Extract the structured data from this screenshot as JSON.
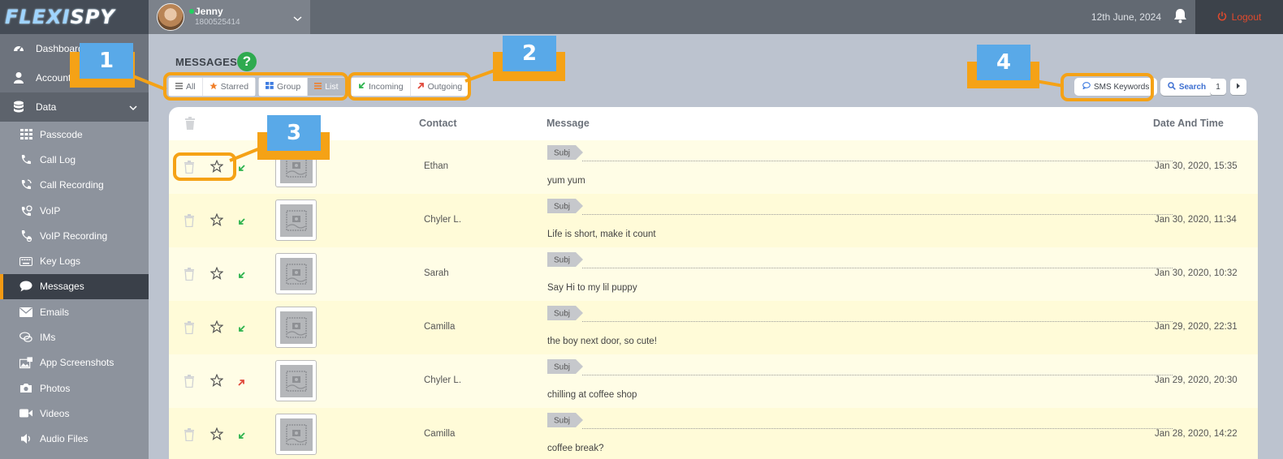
{
  "app": {
    "logo_left": "FLEXI",
    "logo_right": "SPY"
  },
  "user": {
    "name": "Jenny",
    "phone": "1800525414"
  },
  "header": {
    "date": "12th June, 2024",
    "logout_label": "Logout"
  },
  "nav": {
    "top": [
      {
        "label": "Dashboard",
        "icon": "dashboard-icon"
      },
      {
        "label": "Account",
        "icon": "user-icon"
      },
      {
        "label": "Data",
        "icon": "database-icon"
      }
    ],
    "data_items": [
      {
        "label": "Passcode",
        "icon": "grid-icon"
      },
      {
        "label": "Call Log",
        "icon": "phone-icon"
      },
      {
        "label": "Call Recording",
        "icon": "call-recording-icon"
      },
      {
        "label": "VoIP",
        "icon": "voip-icon"
      },
      {
        "label": "VoIP Recording",
        "icon": "voip-recording-icon"
      },
      {
        "label": "Key Logs",
        "icon": "keyboard-icon"
      },
      {
        "label": "Messages",
        "icon": "chat-icon",
        "active": true
      },
      {
        "label": "Emails",
        "icon": "envelope-icon"
      },
      {
        "label": "IMs",
        "icon": "ims-icon"
      },
      {
        "label": "App Screenshots",
        "icon": "screenshot-icon"
      },
      {
        "label": "Photos",
        "icon": "camera-icon"
      },
      {
        "label": "Videos",
        "icon": "video-icon"
      },
      {
        "label": "Audio Files",
        "icon": "audio-icon"
      }
    ]
  },
  "page": {
    "title": "MESSAGES",
    "help": "?",
    "filters": {
      "all": "All",
      "starred": "Starred",
      "group": "Group",
      "list": "List",
      "incoming": "Incoming",
      "outgoing": "Outgoing"
    },
    "sms_keywords": "SMS Keywords",
    "search": "Search",
    "page_number": "1"
  },
  "callouts": [
    "1",
    "2",
    "3",
    "4"
  ],
  "table": {
    "columns": {
      "contact": "Contact",
      "message": "Message",
      "date": "Date And Time"
    },
    "subject_tag": "Subj",
    "rows": [
      {
        "contact": "Ethan",
        "message": "yum yum",
        "date": "Jan 30, 2020, 15:35",
        "direction": "incoming"
      },
      {
        "contact": "Chyler L.",
        "message": "Life is short, make it count",
        "date": "Jan 30, 2020, 11:34",
        "direction": "incoming"
      },
      {
        "contact": "Sarah",
        "message": "Say Hi to my lil puppy",
        "date": "Jan 30, 2020, 10:32",
        "direction": "incoming"
      },
      {
        "contact": "Camilla",
        "message": "the boy next door, so cute!",
        "date": "Jan 29, 2020, 22:31",
        "direction": "incoming"
      },
      {
        "contact": "Chyler L.",
        "message": "chilling at coffee shop",
        "date": "Jan 29, 2020, 20:30",
        "direction": "outgoing"
      },
      {
        "contact": "Camilla",
        "message": "coffee break?",
        "date": "Jan 28, 2020, 14:22",
        "direction": "incoming"
      }
    ]
  },
  "colors": {
    "accent": "#f5a216",
    "callout": "#59a9e8",
    "incoming": "#2bb24c",
    "outgoing": "#e0483b"
  }
}
